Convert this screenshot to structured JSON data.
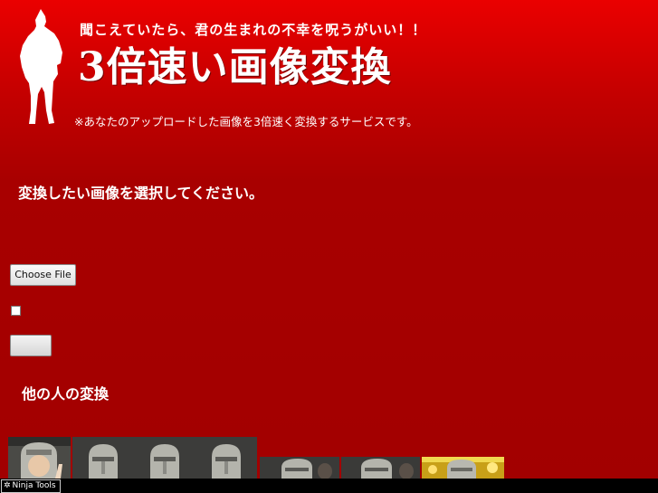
{
  "header": {
    "tagline": "聞こえていたら、君の生まれの不幸を呪うがいい！！",
    "title": "3倍速い画像変換",
    "description": "※あなたのアップロードした画像を3倍速く変換するサービスです。"
  },
  "form": {
    "heading": "変換したい画像を選択してください。",
    "file_button_label": "Choose File",
    "checkbox_checked": false,
    "submit_label": ""
  },
  "gallery": {
    "heading": "他の人の変換",
    "thumbnails": [
      {
        "kind": "mask-face"
      },
      {
        "kind": "mask"
      },
      {
        "kind": "mask"
      },
      {
        "kind": "mask"
      },
      {
        "kind": "mask"
      },
      {
        "kind": "mask"
      },
      {
        "kind": "mask-gold"
      }
    ]
  },
  "toolbar": {
    "ninja_tools_label": "Ninja Tools"
  },
  "colors": {
    "background_top": "#ea0000",
    "background_bottom": "#a20000",
    "text": "#ffffff",
    "mask_silver": "#b8b8b0",
    "gold": "#e8c020"
  }
}
